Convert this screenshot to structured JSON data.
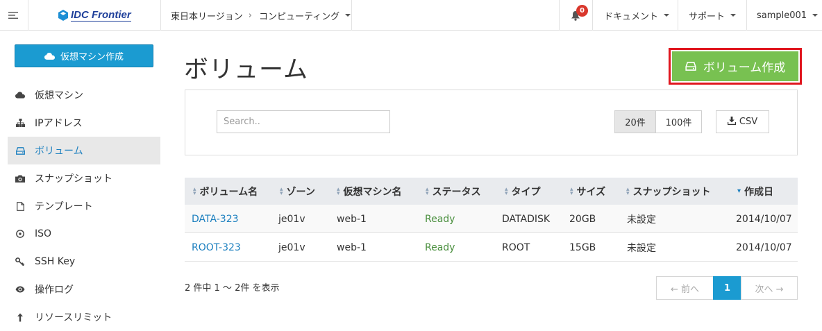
{
  "topbar": {
    "logo_text": "IDC Frontier",
    "region_crumb": "東日本リージョン",
    "crumb_sep": "›",
    "service_crumb": "コンピューティング",
    "notification_count": "0",
    "documents_label": "ドキュメント",
    "support_label": "サポート",
    "user_label": "sample001"
  },
  "sidebar": {
    "create_vm_label": "仮想マシン作成",
    "items": [
      {
        "label": "仮想マシン",
        "icon": "cloud-icon"
      },
      {
        "label": "IPアドレス",
        "icon": "sitemap-icon"
      },
      {
        "label": "ボリューム",
        "icon": "hdd-icon",
        "active": true
      },
      {
        "label": "スナップショット",
        "icon": "camera-icon"
      },
      {
        "label": "テンプレート",
        "icon": "file-icon"
      },
      {
        "label": "ISO",
        "icon": "disc-icon"
      },
      {
        "label": "SSH Key",
        "icon": "key-icon"
      },
      {
        "label": "操作ログ",
        "icon": "eye-icon"
      },
      {
        "label": "リソースリミット",
        "icon": "arrow-up-icon"
      }
    ]
  },
  "main": {
    "title": "ボリューム",
    "create_volume_label": "ボリューム作成",
    "search_placeholder": "Search..",
    "page_size_20": "20件",
    "page_size_100": "100件",
    "csv_label": "CSV",
    "columns": [
      "ボリューム名",
      "ゾーン",
      "仮想マシン名",
      "ステータス",
      "タイプ",
      "サイズ",
      "スナップショット",
      "作成日"
    ],
    "sorted_column": "作成日",
    "rows": [
      {
        "name": "DATA-323",
        "zone": "je01v",
        "vm": "web-1",
        "status": "Ready",
        "type": "DATADISK",
        "size": "20GB",
        "snapshot": "未設定",
        "created": "2014/10/07"
      },
      {
        "name": "ROOT-323",
        "zone": "je01v",
        "vm": "web-1",
        "status": "Ready",
        "type": "ROOT",
        "size": "15GB",
        "snapshot": "未設定",
        "created": "2014/10/07"
      }
    ],
    "showing_text": "2 件中 1 ～ 2件 を表示",
    "pager": {
      "prev": "← 前へ",
      "current": "1",
      "next": "次へ →"
    }
  },
  "colors": {
    "primary": "#1b9bd1",
    "success": "#78c151",
    "highlight_border": "#e0161e",
    "status_ready": "#4a8f3e",
    "badge": "#d9372c"
  }
}
